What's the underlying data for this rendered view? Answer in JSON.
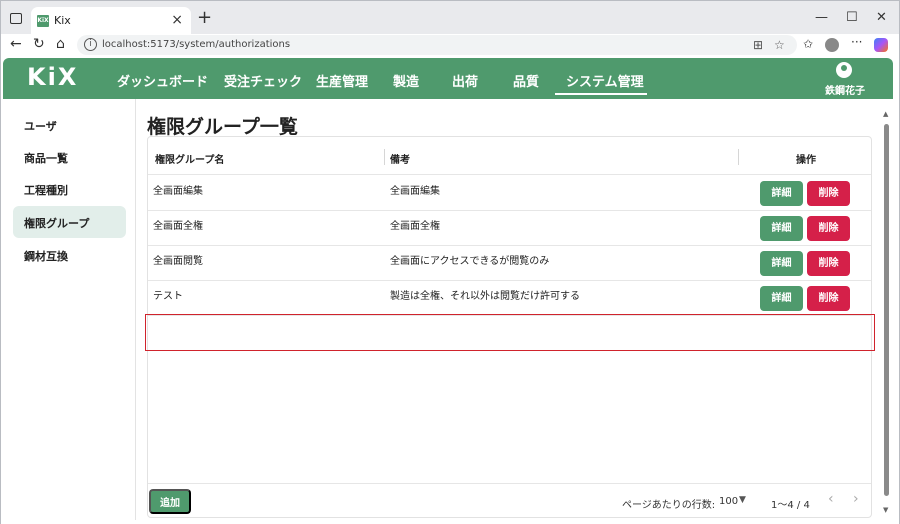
{
  "browser": {
    "tab_favicon_text": "KiX",
    "tab_title": "Kix",
    "url": "localhost:5173/system/authorizations"
  },
  "app": {
    "logo": "KiX",
    "nav": [
      "ダッシュボード",
      "受注チェック",
      "生産管理",
      "製造",
      "出荷",
      "品質",
      "システム管理"
    ],
    "active_nav": "システム管理",
    "user_name": "鉄鋼花子"
  },
  "sidebar": {
    "items": [
      "ユーザ",
      "商品一覧",
      "工程種別",
      "権限グループ",
      "鋼材互換"
    ],
    "active": "権限グループ"
  },
  "page": {
    "title": "権限グループ一覧"
  },
  "table": {
    "columns": [
      "権限グループ名",
      "備考",
      "操作"
    ],
    "rows": [
      {
        "name": "全画面編集",
        "note": "全画面編集"
      },
      {
        "name": "全画面全権",
        "note": "全画面全権"
      },
      {
        "name": "全画面閲覧",
        "note": "全画面にアクセスできるが閲覧のみ"
      },
      {
        "name": "テスト",
        "note": "製造は全権、それ以外は閲覧だけ許可する"
      }
    ],
    "detail_label": "詳細",
    "delete_label": "削除"
  },
  "footer": {
    "add_label": "追加",
    "rows_per_page_label": "ページあたりの行数:",
    "rows_per_page": "100",
    "range": "1〜4 / 4"
  },
  "colors": {
    "primary": "#4f9a6d",
    "danger": "#d52049",
    "highlight": "#d0232c"
  }
}
